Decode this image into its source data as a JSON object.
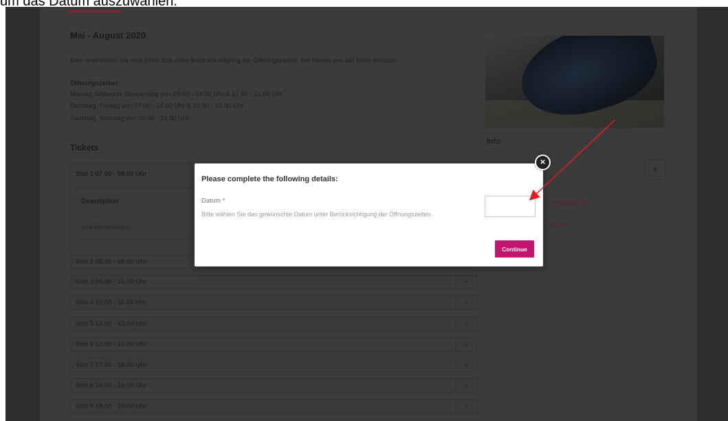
{
  "caption": "um das Datum auszuwählen.",
  "event": {
    "season_title": "Mai - August 2020",
    "intro": "Bitte reservieren Sie sich Ihren Slot unter Berücksichtigung der Öffnungszeiten. Wir freuen uns auf Ihren Besuch!",
    "hours_title": "Öffnungszeiten",
    "hours": [
      "Montag, Mittwoch, Donnerstag von 09.00 - 14.00 Uhr & 17.00 - 21.00 Uhr",
      "Dienstag, Freitag von 07.00 - 14.00 Uhr & 17.00 - 21.00 Uhr",
      "Samstag, Sonntag von 09.00 - 14.00 Uhr"
    ]
  },
  "tickets": {
    "title": "Tickets",
    "open_slot": {
      "label": "Slot 1 07.00 - 08.00 Uhr",
      "description_header": "Description",
      "description_value": "Slot-Reservation"
    },
    "slots": [
      "Slot 2 08.00 - 09.00 Uhr",
      "Slot 3 09.00 - 10.00 Uhr",
      "Slot 4 10.00 - 11.00 Uhr",
      "Slot 5 12.00 - 13.00 Uhr",
      "Slot 6 13.00 - 14.00 Uhr",
      "Slot 7 17.00 - 18.00 Uhr",
      "Slot 8 18.00 - 19.00 Uhr",
      "Slot 9 19.00 - 20.00 Uhr"
    ],
    "plus": "+"
  },
  "info": {
    "title": "Info",
    "line1": "ss-palace.ch/",
    "line2": "ce.ch",
    "line3": "e"
  },
  "modal": {
    "title": "Please complete the following details:",
    "field_label": "Datum *",
    "field_help": "Bitte wählen Sie das gewünschte Datum unter Berücksichtigung der Öffnungszeiten",
    "date_value": "",
    "continue_label": "Continue",
    "close_glyph": "×"
  },
  "colors": {
    "accent": "#c2176e",
    "arrow": "#e8191f",
    "overlay": "#3b3b3b"
  }
}
